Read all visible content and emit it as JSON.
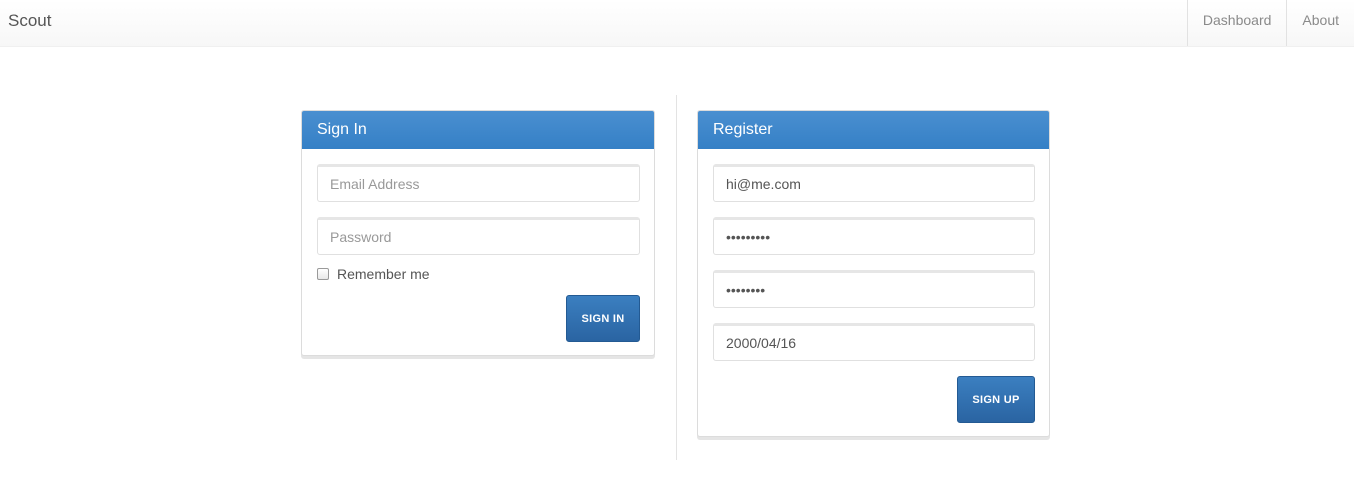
{
  "navbar": {
    "brand": "Scout",
    "links": [
      "Dashboard",
      "About"
    ]
  },
  "signin": {
    "title": "Sign In",
    "email_placeholder": "Email Address",
    "password_placeholder": "Password",
    "remember_label": "Remember me",
    "remember_checked": false,
    "button_label": "SIGN IN"
  },
  "register": {
    "title": "Register",
    "email_value": "hi@me.com",
    "password_value": "•••••••••",
    "confirm_value": "••••••••",
    "date_value": "2000/04/16",
    "button_label": "SIGN UP"
  },
  "colors": {
    "accent": "#3a85c9",
    "button": "#2f6eae"
  }
}
